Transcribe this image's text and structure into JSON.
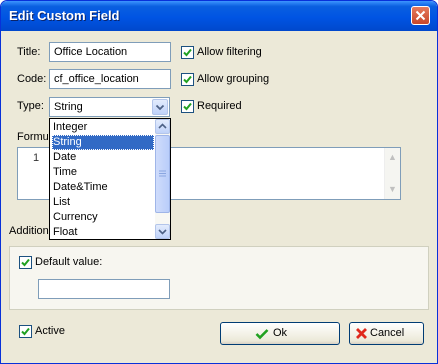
{
  "window": {
    "title": "Edit Custom Field"
  },
  "fields": {
    "title_label": "Title:",
    "title_value": "Office Location",
    "code_label": "Code:",
    "code_value": "cf_office_location",
    "type_label": "Type:",
    "type_value": "String",
    "formula_label": "Formul",
    "formula_line_number": "1"
  },
  "options": {
    "allow_filtering": {
      "label": "Allow filtering",
      "checked": true
    },
    "allow_grouping": {
      "label": "Allow grouping",
      "checked": true
    },
    "required": {
      "label": "Required",
      "checked": true
    }
  },
  "type_dropdown": {
    "items": [
      "Integer",
      "String",
      "Date",
      "Time",
      "Date&Time",
      "List",
      "Currency",
      "Float"
    ],
    "selected": "String"
  },
  "additional": {
    "label": "Addition",
    "default_value": {
      "label": "Default value:",
      "checked": true,
      "value": ""
    }
  },
  "footer": {
    "active": {
      "label": "Active",
      "checked": true
    },
    "ok_label": "Ok",
    "cancel_label": "Cancel"
  },
  "colors": {
    "titlebar": "#0054e3",
    "selection": "#316ac5",
    "check": "#21a121",
    "cancel_x": "#e0281c"
  }
}
